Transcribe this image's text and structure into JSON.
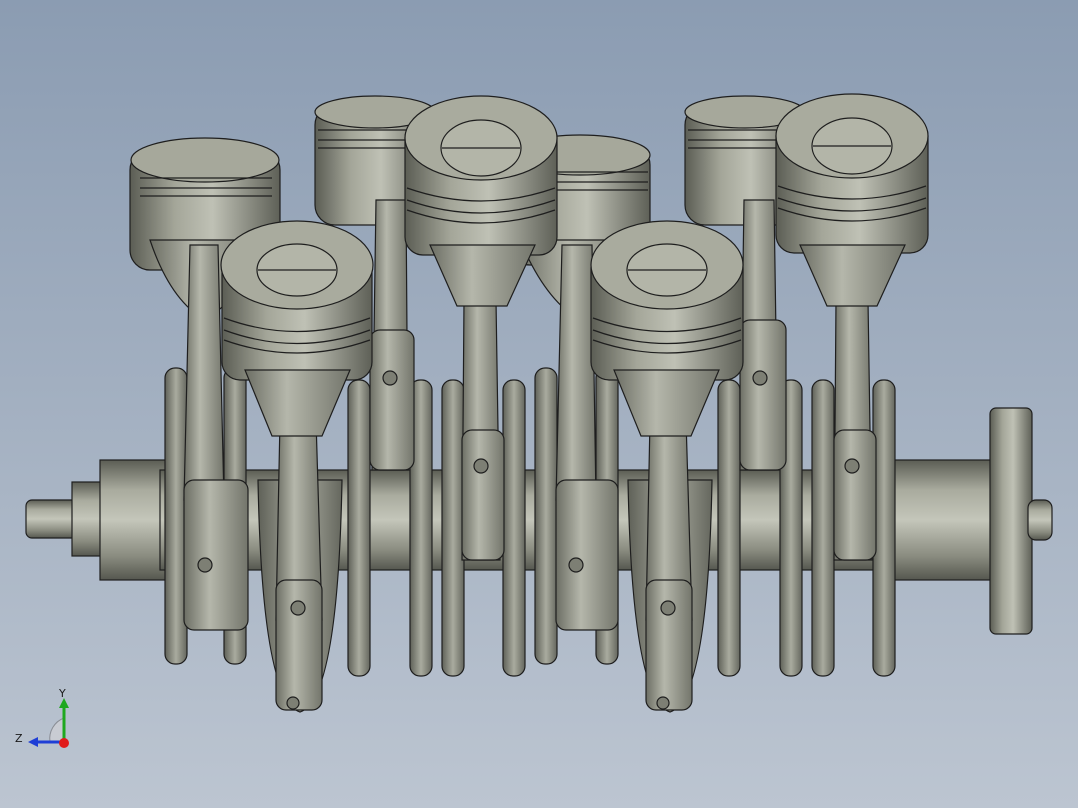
{
  "viewport": {
    "background_top": "#8b9cb2",
    "background_bottom": "#bcc5d1",
    "model_color": "#8f9184",
    "edge_color": "#1e1e1e"
  },
  "triad": {
    "y_label": "Y",
    "z_label": "Z",
    "y_color": "#1fa81f",
    "z_color": "#1f3fd6",
    "x_color": "#e01b1b"
  }
}
